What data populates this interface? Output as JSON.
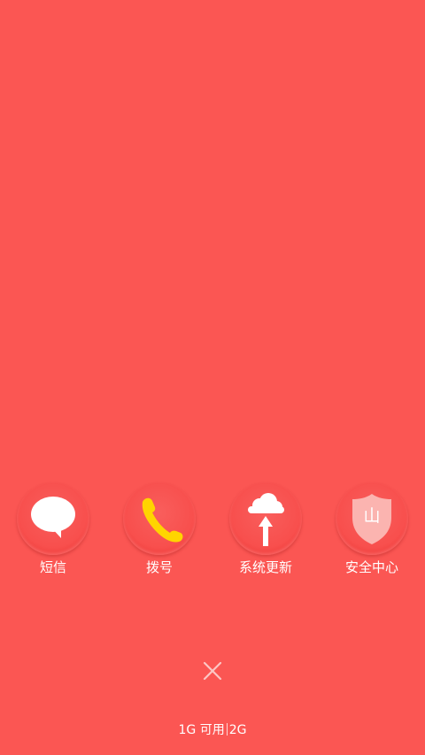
{
  "apps": [
    {
      "label": "短信",
      "icon": "message-bubble-icon"
    },
    {
      "label": "拨号",
      "icon": "phone-handset-icon"
    },
    {
      "label": "系统更新",
      "icon": "cloud-upload-icon"
    },
    {
      "label": "安全中心",
      "icon": "shield-icon"
    }
  ],
  "shield_glyph": "山",
  "close_icon": "close-icon",
  "memory": {
    "available": "1G 可用",
    "total": "2G"
  },
  "colors": {
    "background": "#fb5653",
    "phone_icon": "#ffd400",
    "shield_fill": "#fbb4b0",
    "text": "#ffffff"
  }
}
